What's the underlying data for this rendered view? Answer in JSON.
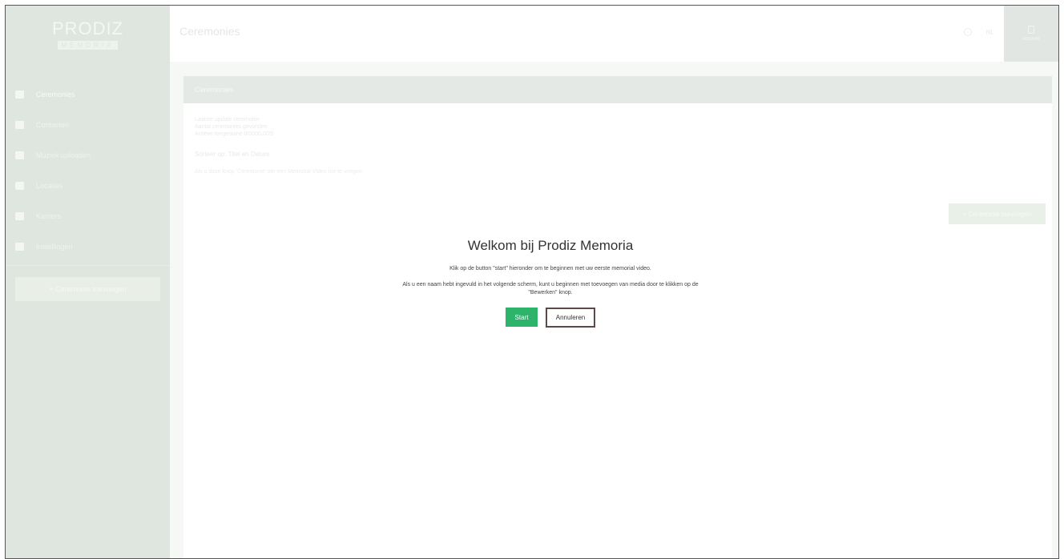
{
  "app": {
    "logo_main": "PRODIZ",
    "logo_sub": "MEMORIA"
  },
  "header": {
    "title": "Ceremonies",
    "language": "NL",
    "account_label": "Account"
  },
  "sidebar": {
    "items": [
      {
        "label": "Ceremonies",
        "icon": "video-camera-icon"
      },
      {
        "label": "Contacten",
        "icon": "user-icon"
      },
      {
        "label": "Muziek uploaden",
        "icon": "music-icon"
      },
      {
        "label": "Locaties",
        "icon": "monitor-icon"
      },
      {
        "label": "Kamers",
        "icon": "calendar-icon"
      },
      {
        "label": "Instellingen",
        "icon": "settings-icon"
      }
    ],
    "add_button": "+ Ceremonie toevoegen"
  },
  "panel": {
    "title": "Ceremonies",
    "info_lines": [
      "Laatste update ceremonie",
      "Aantal ceremonies gevonden",
      "Actieve toegestane 0/5000,0/20"
    ],
    "sort_label": "Sorteer op: Titel en Datum",
    "hint": "Als u deze knop ‘Ceremonie’ om een Memorial Video toe te voegen",
    "add_button": "+ Ceremonie toevoegen"
  },
  "modal": {
    "title": "Welkom bij Prodiz Memoria",
    "text1": "Klik op de button \"start\" hieronder om te beginnen met uw eerste memorial video.",
    "text2": "Als u een naam hebt ingevuld in het volgende scherm, kunt u beginnen met toevoegen van media door te klikken op de \"Bewerken\" knop.",
    "start_label": "Start",
    "cancel_label": "Annuleren"
  },
  "colors": {
    "accent_green": "#2eb46a",
    "sidebar_bg": "#dfe5df",
    "cancel_border": "#5b4a48"
  }
}
